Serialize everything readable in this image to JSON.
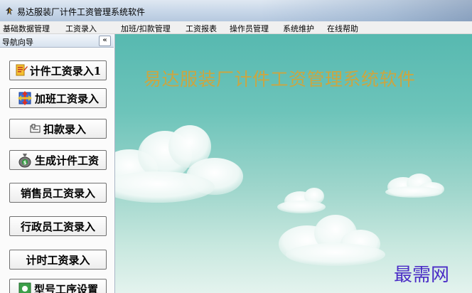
{
  "window": {
    "title": "易达服装厂计件工资管理系统软件",
    "icon": "app-logo-icon"
  },
  "menu": {
    "items": [
      {
        "label": "基础数据管理"
      },
      {
        "label": "工资录入"
      },
      {
        "label": "加班/扣款管理"
      },
      {
        "label": "工资报表"
      },
      {
        "label": "操作员管理"
      },
      {
        "label": "系统维护"
      },
      {
        "label": "在线帮助"
      }
    ]
  },
  "sidebar": {
    "title": "导航向导",
    "collapse_label": "«",
    "buttons": [
      {
        "label": "计件工资录入1",
        "icon": "document-edit-icon"
      },
      {
        "label": "加班工资录入",
        "icon": "arrows-icon"
      },
      {
        "label": "扣款录入",
        "icon": "deduct-icon"
      },
      {
        "label": "生成计件工资",
        "icon": "money-bag-icon"
      },
      {
        "label": "销售员工资录入",
        "icon": ""
      },
      {
        "label": "行政员工资录入",
        "icon": ""
      },
      {
        "label": "计时工资录入",
        "icon": ""
      },
      {
        "label": "型号工序设置",
        "icon": "settings-icon"
      }
    ]
  },
  "main": {
    "heading": "易达服装厂计件工资管理系统软件",
    "watermark": "最需网"
  },
  "colors": {
    "heading": "#caa642",
    "watermark": "#4a2cc6",
    "background_top": "#57b9b0",
    "background_bottom": "#e4f3ee"
  }
}
